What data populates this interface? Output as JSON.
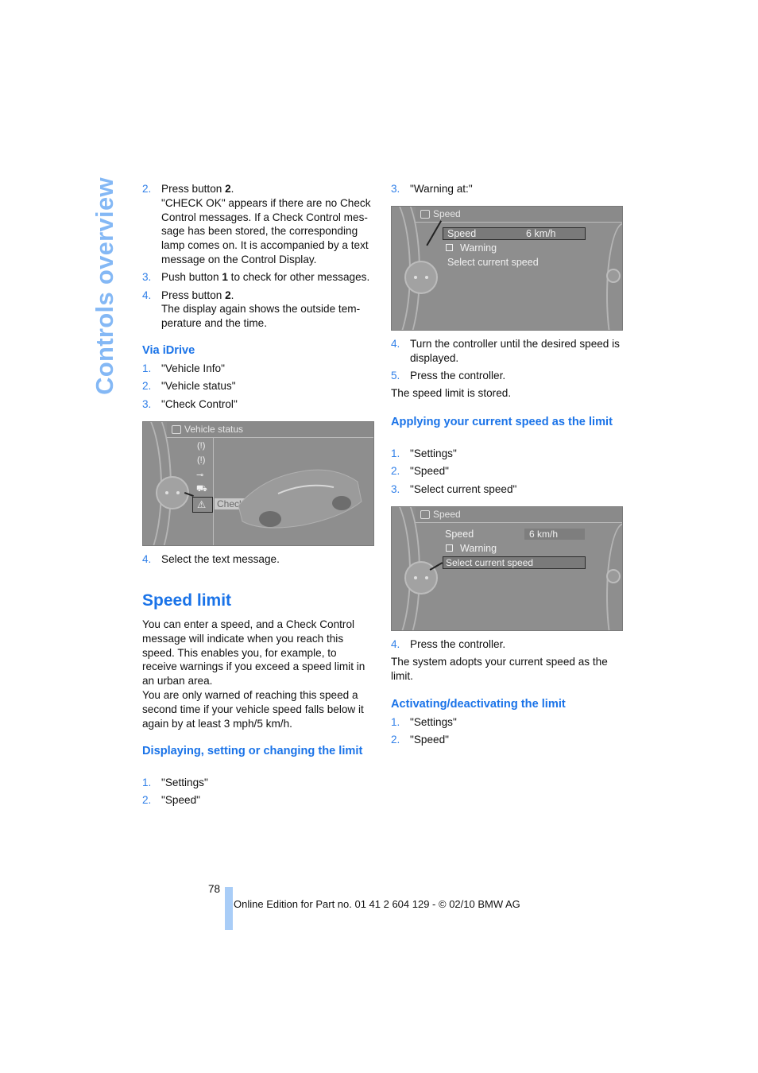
{
  "side_title": "Controls overview",
  "left_column": {
    "intro_steps": [
      {
        "num": "2.",
        "text_prefix": "Press button ",
        "bold": "2",
        "text_suffix": ".",
        "detail": "\"CHECK OK\" appears if there are no Check Control messages. If a Check Control mes-sage has been stored, the corresponding lamp comes on. It is accompanied by a text message on the Control Display."
      },
      {
        "num": "3.",
        "text_prefix": "Push button ",
        "bold": "1",
        "text_suffix": " to check for other messages.",
        "detail": ""
      },
      {
        "num": "4.",
        "text_prefix": "Press button ",
        "bold": "2",
        "text_suffix": ".",
        "detail": "The display again shows the outside tem-perature and the time."
      }
    ],
    "via_idrive_heading": "Via iDrive",
    "via_idrive_steps": [
      {
        "num": "1.",
        "text": "\"Vehicle Info\""
      },
      {
        "num": "2.",
        "text": "\"Vehicle status\""
      },
      {
        "num": "3.",
        "text": "\"Check Control\""
      }
    ],
    "screen1": {
      "title": "Vehicle status",
      "selected_label": "Check Control"
    },
    "step4": {
      "num": "4.",
      "text": "Select the text message."
    },
    "speed_limit_heading": "Speed limit",
    "speed_limit_para1": "You can enter a speed, and a Check Control message will indicate when you reach this speed. This enables you, for example, to receive warnings if you exceed a speed limit in an urban area.",
    "speed_limit_para2": "You are only warned of reaching this speed a second time if your vehicle speed falls below it again by at least 3 mph/5 km/h.",
    "displaying_heading": "Displaying, setting or changing the limit",
    "displaying_steps": [
      {
        "num": "1.",
        "text": "\"Settings\""
      },
      {
        "num": "2.",
        "text": "\"Speed\""
      }
    ]
  },
  "right_column": {
    "step3": {
      "num": "3.",
      "text": "\"Warning at:\""
    },
    "screen2": {
      "title": "Speed",
      "speed_label": "Speed",
      "speed_value": "6 km/h",
      "warning_label": "Warning",
      "select_label": "Select current speed"
    },
    "steps_after": [
      {
        "num": "4.",
        "text": "Turn the controller until the desired speed is displayed."
      },
      {
        "num": "5.",
        "text": "Press the controller."
      }
    ],
    "stored_text": "The speed limit is stored.",
    "applying_heading": "Applying your current speed as the limit",
    "applying_steps": [
      {
        "num": "1.",
        "text": "\"Settings\""
      },
      {
        "num": "2.",
        "text": "\"Speed\""
      },
      {
        "num": "3.",
        "text": "\"Select current speed\""
      }
    ],
    "screen3": {
      "title": "Speed",
      "speed_label": "Speed",
      "speed_value": "6 km/h",
      "warning_label": "Warning",
      "select_label": "Select current speed"
    },
    "step4b": {
      "num": "4.",
      "text": "Press the controller."
    },
    "adopts_text": "The system adopts your current speed as the limit.",
    "activating_heading": "Activating/deactivating the limit",
    "activating_steps": [
      {
        "num": "1.",
        "text": "\"Settings\""
      },
      {
        "num": "2.",
        "text": "\"Speed\""
      }
    ]
  },
  "footer": {
    "page_number": "78",
    "edition_text": "Online Edition for Part no. 01 41 2 604 129 - © 02/10 BMW AG"
  }
}
